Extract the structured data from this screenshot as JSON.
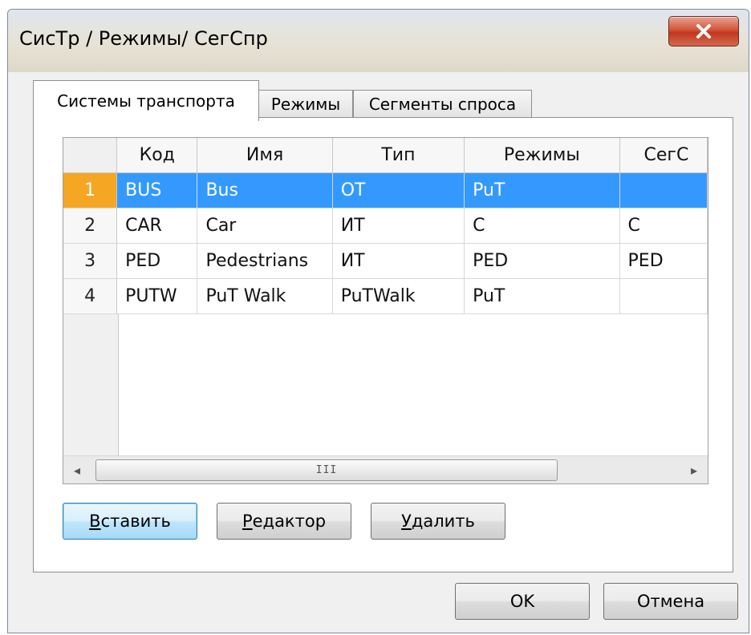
{
  "window": {
    "title": "СисТр / Режимы/ СегСпр",
    "close_glyph": "x"
  },
  "tabs": [
    {
      "label": "Системы транспорта",
      "active": true
    },
    {
      "label": "Режимы",
      "active": false
    },
    {
      "label": "Сегменты спроса",
      "active": false
    }
  ],
  "grid": {
    "columns": [
      "Код",
      "Имя",
      "Тип",
      "Режимы",
      "СегС"
    ],
    "rows": [
      {
        "num": "1",
        "cells": [
          "BUS",
          "Bus",
          "ОТ",
          "PuT",
          ""
        ],
        "selected": true
      },
      {
        "num": "2",
        "cells": [
          "CAR",
          "Car",
          "ИТ",
          "C",
          "C"
        ],
        "selected": false
      },
      {
        "num": "3",
        "cells": [
          "PED",
          "Pedestrians",
          "ИТ",
          "PED",
          "PED"
        ],
        "selected": false
      },
      {
        "num": "4",
        "cells": [
          "PUTW",
          "PuT Walk",
          "PuTWalk",
          "PuT",
          ""
        ],
        "selected": false
      }
    ],
    "scroll_left_glyph": "◂",
    "scroll_right_glyph": "▸",
    "scroll_grip": "III"
  },
  "actions": {
    "insert": {
      "accel": "В",
      "rest": "ставить"
    },
    "editor": {
      "accel": "Р",
      "rest": "едактор"
    },
    "delete": {
      "accel": "У",
      "rest": "далить"
    }
  },
  "footer": {
    "ok_label": "OK",
    "cancel_label": "Отмена"
  },
  "colors": {
    "selection": "#3399ff",
    "selected_row_number": "#f5a623",
    "close_button": "#c0381f"
  }
}
